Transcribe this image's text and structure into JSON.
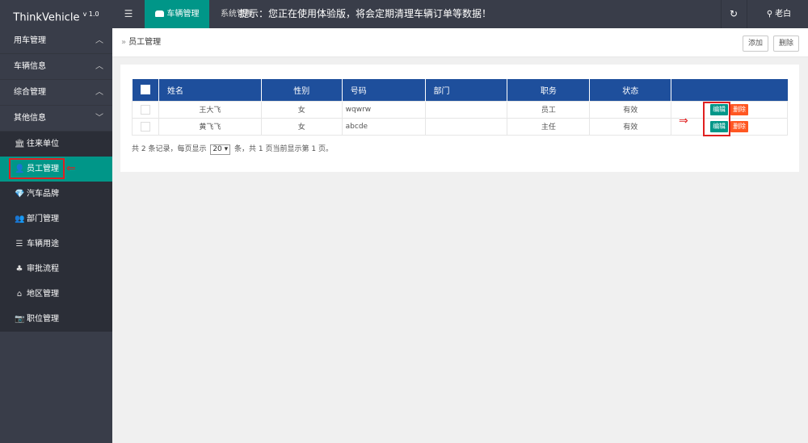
{
  "header": {
    "logo": "ThinkVehicle",
    "version": "v 1.0",
    "menu_icon": "☰",
    "active_tab": "车辆管理",
    "link": "系统管理",
    "notice": "提示：您正在使用体验版，将会定期清理车辆订单等数据！",
    "refresh_icon": "↻",
    "user_icon": "⚲",
    "user": "老白"
  },
  "sidebar": {
    "groups": [
      {
        "label": "用车管理",
        "chev": "︿"
      },
      {
        "label": "车辆信息",
        "chev": "︿"
      },
      {
        "label": "综合管理",
        "chev": "︿"
      },
      {
        "label": "其他信息",
        "chev": "﹀"
      }
    ],
    "items": [
      {
        "label": "往来单位",
        "icon": "🏛"
      },
      {
        "label": "员工管理",
        "icon": "👤"
      },
      {
        "label": "汽车品牌",
        "icon": "💎"
      },
      {
        "label": "部门管理",
        "icon": "👥"
      },
      {
        "label": "车辆用途",
        "icon": "☰"
      },
      {
        "label": "审批流程",
        "icon": "♣"
      },
      {
        "label": "地区管理",
        "icon": "⌂"
      },
      {
        "label": "职位管理",
        "icon": "📷"
      }
    ]
  },
  "breadcrumb": {
    "sep": "»",
    "current": "员工管理"
  },
  "toolbar": {
    "add_label": "添加",
    "delete_label": "删除"
  },
  "table": {
    "columns": [
      "姓名",
      "性别",
      "号码",
      "部门",
      "职务",
      "状态"
    ],
    "rows": [
      {
        "name": "王大飞",
        "gender": "女",
        "number": "wqwrw",
        "dept": "",
        "position": "员工",
        "status": "有效"
      },
      {
        "name": "黄飞飞",
        "gender": "女",
        "number": "abcde",
        "dept": "",
        "position": "主任",
        "status": "有效"
      }
    ],
    "edit_label": "编辑",
    "delete_label": "删除"
  },
  "pager": {
    "prefix": "共 2 条记录，每页显示",
    "page_size": "20 ▾",
    "suffix": "条，共 1 页当前显示第 1 页。"
  },
  "colors": {
    "accent": "#009688",
    "header_bg": "#393d49",
    "table_head": "#1e4f9c",
    "danger": "#ff5722",
    "highlight": "#e02020"
  }
}
